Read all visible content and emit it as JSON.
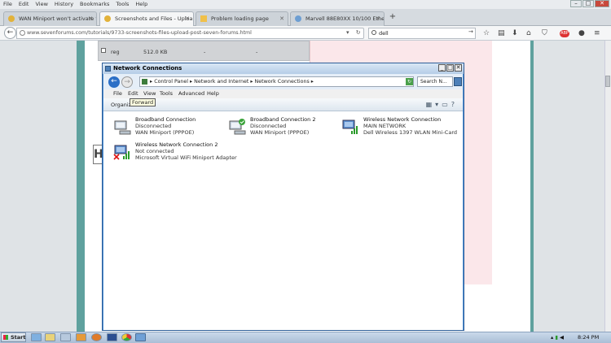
{
  "browser": {
    "menu": [
      "File",
      "Edit",
      "View",
      "History",
      "Bookmarks",
      "Tools",
      "Help"
    ],
    "tabs": [
      {
        "label": "WAN Miniport won't activate f...",
        "active": false,
        "icon": "sevenforums-favicon"
      },
      {
        "label": "Screenshots and Files - Uploa...",
        "active": true,
        "icon": "sevenforums-favicon"
      },
      {
        "label": "Problem loading page",
        "active": false,
        "icon": "warning-icon"
      },
      {
        "label": "Marvell 88E80XX 10/100 Ethe...",
        "active": false,
        "icon": "globe-icon"
      }
    ],
    "new_tab": "+",
    "url": "www.sevenforums.com/tutorials/9733-screenshots-files-upload-post-seven-forums.html",
    "search_value": "dell",
    "colors": {
      "accent": "#2b6fc6",
      "page_border": "#5fa19e"
    }
  },
  "page": {
    "attachment_row": {
      "name": "reg",
      "size": "512.0 KB",
      "col3": "-",
      "col4": "-"
    },
    "badge_letter": "H"
  },
  "network_window": {
    "title": "Network Connections",
    "address": {
      "crumbs": [
        "Control Panel",
        "Network and Internet",
        "Network Connections"
      ],
      "separator": "▸"
    },
    "search_placeholder": "Search N...",
    "menu": [
      "File",
      "Edit",
      "View",
      "Tools",
      "Advanced",
      "Help"
    ],
    "tooltip": "Forward",
    "organize_label": "Organize ▾",
    "connections": [
      {
        "name": "Broadband Connection",
        "status": "Disconnected",
        "device": "WAN Miniport (PPPOE)",
        "icon": "broadband-icon",
        "badge": ""
      },
      {
        "name": "Broadband Connection 2",
        "status": "Disconnected",
        "device": "WAN Miniport (PPPOE)",
        "icon": "broadband-icon",
        "badge": "check"
      },
      {
        "name": "Wireless Network Connection",
        "status": "MAIN NETWORK",
        "device": "Dell Wireless 1397 WLAN Mini-Card",
        "icon": "wireless-icon",
        "badge": ""
      },
      {
        "name": "Wireless Network Connection 2",
        "status": "Not connected",
        "device": "Microsoft Virtual WiFi Miniport Adapter",
        "icon": "wireless-icon",
        "badge": "x"
      }
    ]
  },
  "taskbar": {
    "start_label": "Start",
    "clock": "8:24 PM",
    "apps": [
      "ie-icon",
      "explorer-icon",
      "media-icon",
      "firefox-icon",
      "word-icon",
      "chrome-icon",
      "network-icon"
    ]
  }
}
